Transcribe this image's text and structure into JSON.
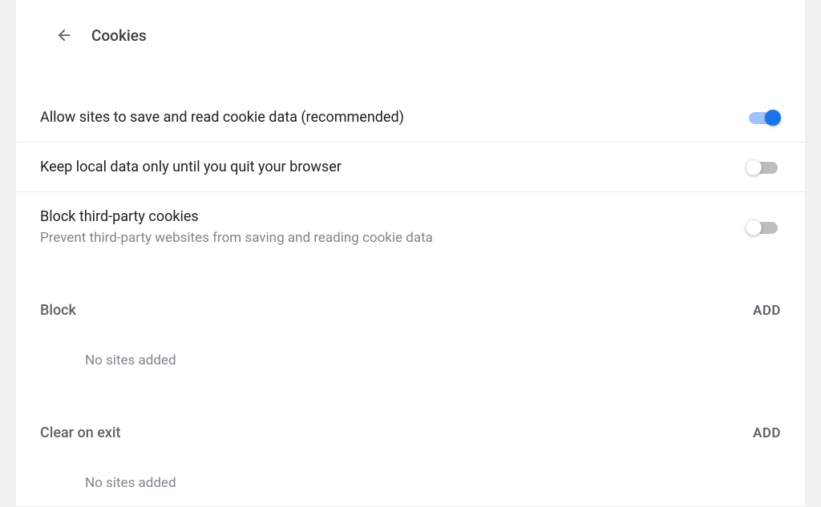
{
  "header": {
    "title": "Cookies"
  },
  "settings": [
    {
      "label": "Allow sites to save and read cookie data (recommended)",
      "sublabel": "",
      "state": "on"
    },
    {
      "label": "Keep local data only until you quit your browser",
      "sublabel": "",
      "state": "off"
    },
    {
      "label": "Block third-party cookies",
      "sublabel": "Prevent third-party websites from saving and reading cookie data",
      "state": "off"
    }
  ],
  "sections": [
    {
      "title": "Block",
      "add_label": "ADD",
      "empty_text": "No sites added"
    },
    {
      "title": "Clear on exit",
      "add_label": "ADD",
      "empty_text": "No sites added"
    }
  ]
}
